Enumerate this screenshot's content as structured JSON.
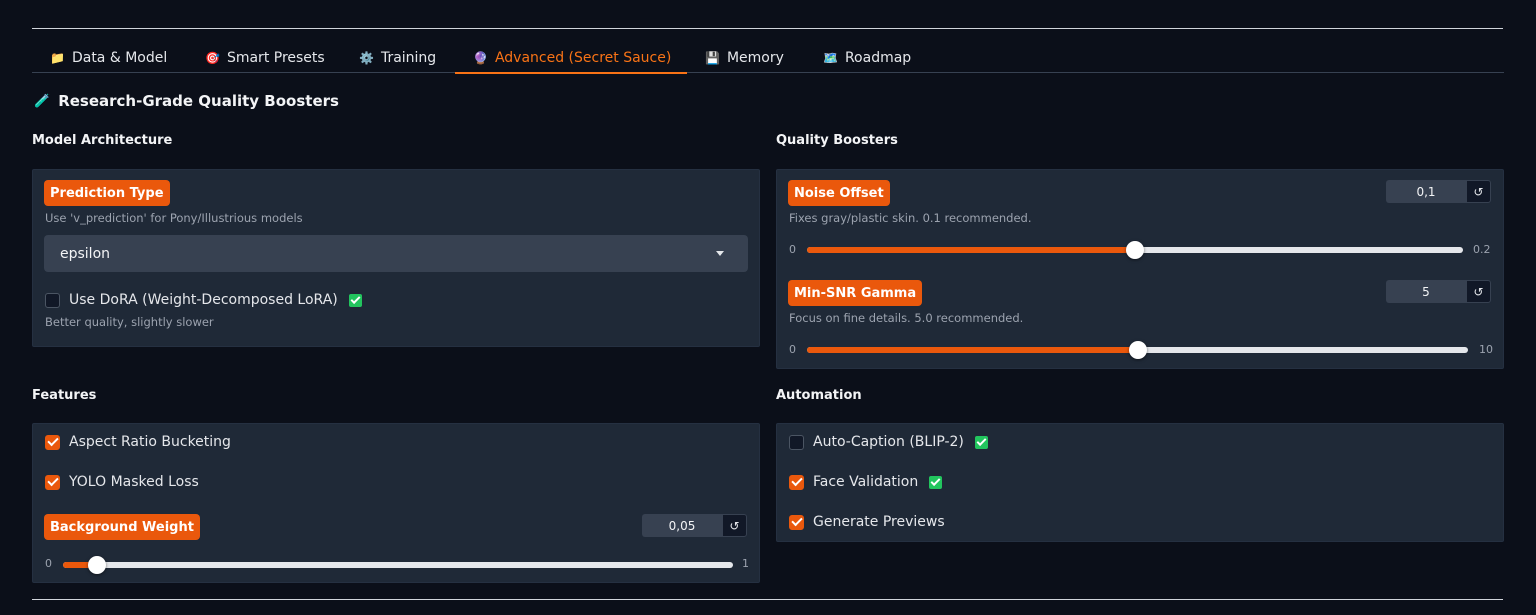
{
  "tabs": [
    {
      "icon": "📁",
      "label": "Data & Model"
    },
    {
      "icon": "🎯",
      "label": "Smart Presets"
    },
    {
      "icon": "⚙️",
      "label": "Training"
    },
    {
      "icon": "🔮",
      "label": "Advanced (Secret Sauce)"
    },
    {
      "icon": "💾",
      "label": "Memory"
    },
    {
      "icon": "🗺️",
      "label": "Roadmap"
    }
  ],
  "heading": {
    "icon": "🧪",
    "text": "Research-Grade Quality Boosters"
  },
  "model_architecture": {
    "title": "Model Architecture",
    "prediction_type": {
      "label": "Prediction Type",
      "info": "Use 'v_prediction' for Pony/Illustrious models",
      "value": "epsilon"
    },
    "dora": {
      "label": "Use DoRA (Weight-Decomposed LoRA)",
      "checked": false,
      "info": "Better quality, slightly slower"
    }
  },
  "quality_boosters": {
    "title": "Quality Boosters",
    "noise_offset": {
      "label": "Noise Offset",
      "info": "Fixes gray/plastic skin. 0.1 recommended.",
      "value": "0,1",
      "value_num": 0.1,
      "min": "0",
      "max": "0.2",
      "min_num": 0,
      "max_num": 0.2
    },
    "min_snr": {
      "label": "Min-SNR Gamma",
      "info": "Focus on fine details. 5.0 recommended.",
      "value": "5",
      "value_num": 5,
      "min": "0",
      "max": "10",
      "min_num": 0,
      "max_num": 10
    }
  },
  "features": {
    "title": "Features",
    "aspect_ratio": {
      "label": "Aspect Ratio Bucketing",
      "checked": true
    },
    "yolo": {
      "label": "YOLO Masked Loss",
      "checked": true
    },
    "background_weight": {
      "label": "Background Weight",
      "value": "0,05",
      "value_num": 0.05,
      "min": "0",
      "max": "1",
      "min_num": 0,
      "max_num": 1
    }
  },
  "automation": {
    "title": "Automation",
    "auto_caption": {
      "label": "Auto-Caption (BLIP-2)",
      "checked": false
    },
    "face_validation": {
      "label": "Face Validation",
      "checked": true
    },
    "generate_previews": {
      "label": "Generate Previews",
      "checked": true
    }
  },
  "reset_symbol": "↺",
  "colors": {
    "accent": "#ea580c",
    "active_tab": "#f97316",
    "background": "#0b0f19",
    "panel": "#1f2937",
    "badge_check": "#22c55e"
  }
}
